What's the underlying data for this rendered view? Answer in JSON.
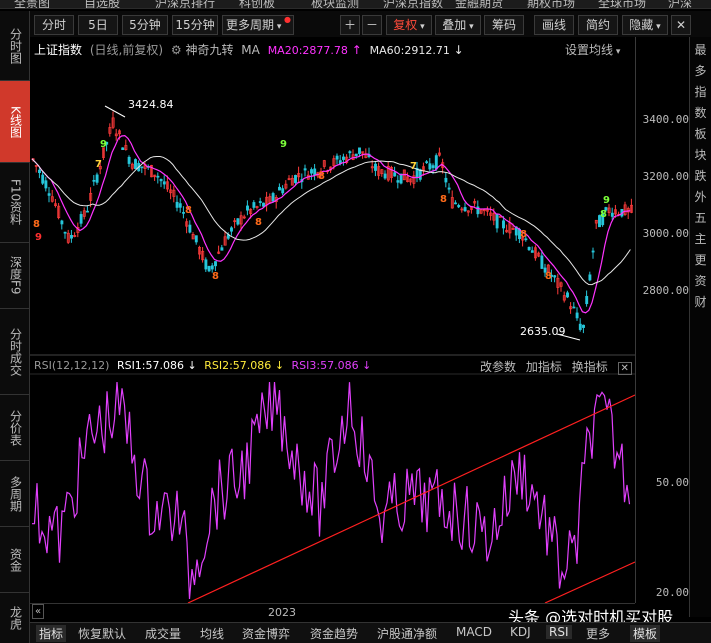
{
  "top_menu": [
    "全景图",
    "自选股",
    "沪深京排行",
    "科创板",
    "板块监测",
    "沪深京指数",
    "金融期货",
    "期权市场",
    "全球市场",
    "沪深"
  ],
  "toolbar": {
    "items": [
      "分时",
      "5日",
      "5分钟",
      "15分钟",
      "更多周期"
    ],
    "icons": [
      "＋",
      "－"
    ],
    "right_items": [
      "复权",
      "叠加",
      "筹码",
      "画线",
      "简约",
      "隐藏"
    ],
    "close": "✕"
  },
  "sidebar": {
    "items": [
      "分时图",
      "K线图",
      "F10资料",
      "深度F9",
      "分时成交",
      "分价表",
      "多周期",
      "资金",
      "龙虎"
    ]
  },
  "right_col": [
    "最",
    "多",
    "指",
    "数",
    "板",
    "块",
    "跌",
    "外",
    "五",
    "主",
    "更",
    "资",
    "财"
  ],
  "main_panel": {
    "title": "上证指数",
    "subtitle": "(日线,前复权)",
    "indicator": "神奇九转",
    "ma_label": "MA",
    "ma20": "MA20:2877.78",
    "ma60": "MA60:2912.71",
    "settings": "设置均线",
    "high_label": "3424.84",
    "low_label": "2635.09",
    "y_ticks": [
      "3400.00",
      "3200.00",
      "3000.00",
      "2800.00"
    ]
  },
  "rsi_panel": {
    "title": "RSI(12,12,12)",
    "rsi1": "RSI1:57.086",
    "rsi2": "RSI2:57.086",
    "rsi3": "RSI3:57.086",
    "change_param": "改参数",
    "add_indicator": "加指标",
    "switch_indicator": "换指标",
    "y_ticks": [
      "50.00",
      "20.00"
    ]
  },
  "x_axis": {
    "label": "2023"
  },
  "bottom_bar": [
    "指标",
    "恢复默认",
    "成交量",
    "均线",
    "资金博弈",
    "资金趋势",
    "沪股通净额",
    "MACD",
    "KDJ",
    "RSI",
    "更多",
    "模板"
  ],
  "watermark": "头条 @选对时机买对股",
  "colors": {
    "up": "#ff3b3b",
    "down": "#26c6da",
    "ma20": "#ff33ff",
    "ma60": "#ffffff",
    "rsi": "#e040fb",
    "trend": "#ff2020",
    "active": "#d0392b"
  }
}
